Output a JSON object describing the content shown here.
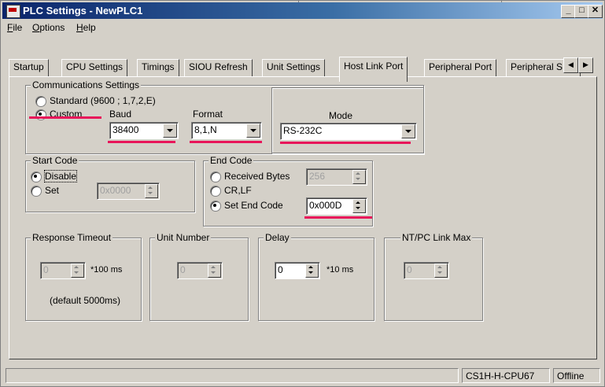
{
  "window": {
    "title": "PLC Settings - NewPLC1"
  },
  "menu": [
    {
      "label": "File",
      "underline": "F",
      "rest": "ile"
    },
    {
      "label": "Options",
      "underline": "O",
      "rest": "ptions"
    },
    {
      "label": "Help",
      "underline": "H",
      "rest": "elp"
    }
  ],
  "tabs": [
    "Startup",
    "CPU Settings",
    "Timings",
    "SIOU Refresh",
    "Unit Settings",
    "Host Link Port",
    "Peripheral Port",
    "Peripheral S"
  ],
  "active_tab": "Host Link Port",
  "comm": {
    "legend": "Communications Settings",
    "standard_label": "Standard (9600 ; 1,7,2,E)",
    "custom_label": "Custom",
    "baud_label": "Baud",
    "baud_value": "38400",
    "format_label": "Format",
    "format_value": "8,1,N",
    "mode_label": "Mode",
    "mode_value": "RS-232C"
  },
  "start_code": {
    "legend": "Start Code",
    "disable_label": "Disable",
    "set_label": "Set",
    "value": "0x0000"
  },
  "end_code": {
    "legend": "End Code",
    "received_label": "Received Bytes",
    "received_value": "256",
    "crlf_label": "CR,LF",
    "set_label": "Set End Code",
    "value": "0x000D"
  },
  "response_timeout": {
    "legend": "Response Timeout",
    "value": "0",
    "unit": "*100 ms",
    "note": "(default 5000ms)"
  },
  "unit_number": {
    "legend": "Unit Number",
    "value": "0"
  },
  "delay": {
    "legend": "Delay",
    "value": "0",
    "unit": "*10 ms"
  },
  "ntpc": {
    "legend": "NT/PC Link Max",
    "value": "0"
  },
  "status": {
    "cpu": "CS1H-H-CPU67",
    "mode": "Offline"
  },
  "colors": {
    "title_bar": "#0a246a",
    "highlight": "#e8155a",
    "face": "#d4d0c8"
  }
}
